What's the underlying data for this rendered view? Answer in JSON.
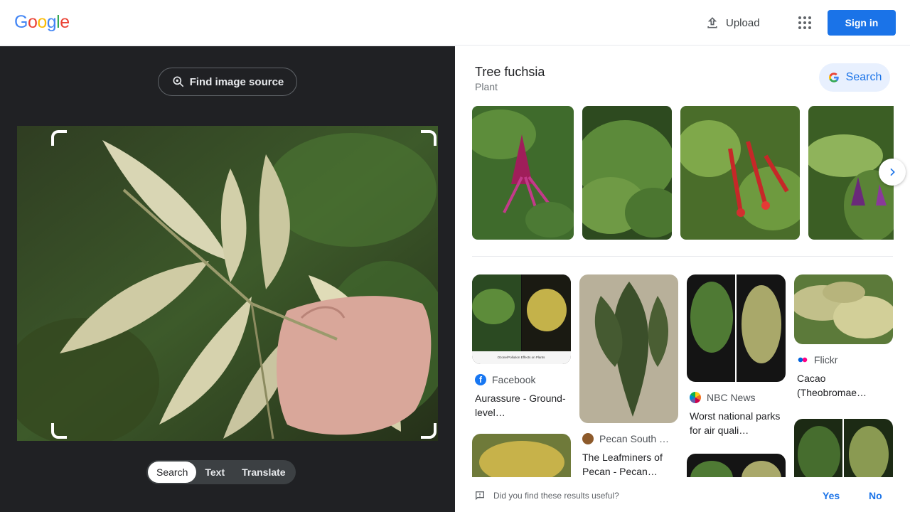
{
  "header": {
    "logo": [
      "G",
      "o",
      "o",
      "g",
      "l",
      "e"
    ],
    "logo_colors": [
      "#4285f4",
      "#ea4335",
      "#fbbc05",
      "#4285f4",
      "#34a853",
      "#ea4335"
    ],
    "upload_label": "Upload",
    "signin_label": "Sign in"
  },
  "lens": {
    "find_source_label": "Find image source",
    "modes": [
      "Search",
      "Text",
      "Translate"
    ],
    "active_mode": "Search"
  },
  "results": {
    "entity_title": "Tree fuchsia",
    "entity_type": "Plant",
    "search_label": "Search",
    "cards": [
      {
        "source": "Facebook",
        "title": "Aurassure - Ground-level…",
        "source_icon": "facebook-icon"
      },
      {
        "source": "Pecan South …",
        "title": "The Leafminers of Pecan - Pecan…",
        "source_icon": "pecan-south-icon"
      },
      {
        "source": "NBC News",
        "title": "Worst national parks for air quali…",
        "source_icon": "nbc-icon"
      },
      {
        "source": "Flickr",
        "title": "Cacao (Theobromae…",
        "source_icon": "flickr-icon"
      }
    ],
    "card_caption": "Ozone/Pollution Effects on Plants"
  },
  "feedback": {
    "question": "Did you find these results useful?",
    "yes": "Yes",
    "no": "No"
  },
  "colors": {
    "accent": "#1a73e8",
    "dark_panel": "#202124"
  }
}
